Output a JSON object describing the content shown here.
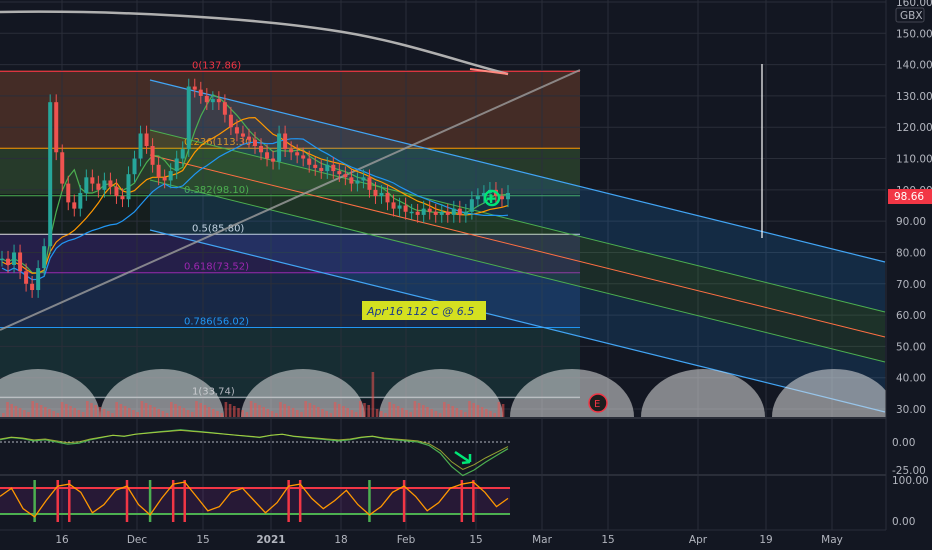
{
  "currency": "GBX",
  "last_price": "98.66",
  "earnings_marker": "E",
  "annotation": "Apr'16 112 C @ 6.5",
  "colors": {
    "background": "#131722",
    "price_badge": "#f23645",
    "channel_blue": "#2962ff",
    "channel_green": "#4caf50",
    "channel_red": "#ff6d00",
    "annotation_bg": "#d4e020"
  },
  "chart_data": [
    {
      "type": "line",
      "id": "price",
      "ylim": [
        30,
        160
      ],
      "y_ticks": [
        "160.00",
        "150.00",
        "140.00",
        "130.00",
        "120.00",
        "110.00",
        "100.00",
        "90.00",
        "80.00",
        "70.00",
        "60.00",
        "50.00",
        "40.00",
        "30.00"
      ],
      "x_ticks": [
        "16",
        "Dec",
        "15",
        "2021",
        "18",
        "Feb",
        "15",
        "Mar",
        "15",
        "Apr",
        "19",
        "May"
      ],
      "fib_levels": [
        {
          "label": "0(137.86)",
          "value": 137.86,
          "color": "#f23645"
        },
        {
          "label": "0.236(113.30)",
          "value": 113.3,
          "color": "#ff9800"
        },
        {
          "label": "0.382(98.10)",
          "value": 98.1,
          "color": "#4caf50"
        },
        {
          "label": "0.5(85.80)",
          "value": 85.8,
          "color": "#e0e0e0"
        },
        {
          "label": "0.618(73.52)",
          "value": 73.52,
          "color": "#9c27b0"
        },
        {
          "label": "0.786(56.02)",
          "value": 56.02,
          "color": "#2196f3"
        },
        {
          "label": "1(33.74)",
          "value": 33.74,
          "color": "#b2b5be"
        }
      ],
      "series": [
        {
          "values": [
            78,
            76,
            80,
            74,
            70,
            68,
            75,
            82,
            128,
            112,
            102,
            96,
            94,
            99,
            104,
            102,
            100,
            103,
            101,
            98,
            97,
            105,
            110,
            118,
            114,
            108,
            104,
            103,
            106,
            110,
            113,
            133,
            132,
            130,
            128,
            129,
            128,
            124,
            120,
            118,
            117,
            116,
            114,
            112,
            110,
            109,
            118,
            113,
            112,
            111,
            110,
            108,
            107,
            106,
            108,
            106,
            105,
            104,
            102,
            103,
            104,
            100,
            98,
            99,
            96,
            94,
            95,
            93,
            93,
            92,
            94,
            93,
            92,
            93,
            92,
            94,
            92,
            93,
            97,
            98,
            99,
            100,
            98,
            97,
            99
          ]
        }
      ]
    },
    {
      "type": "line",
      "id": "oscillator",
      "y_ticks": [
        "0.00",
        "-25.00"
      ],
      "series": [
        {
          "values": [
            2,
            4,
            3,
            1,
            2,
            0,
            -2,
            -1,
            2,
            4,
            6,
            5,
            7,
            8,
            9,
            10,
            11,
            10,
            9,
            8,
            7,
            6,
            5,
            4,
            6,
            7,
            5,
            4,
            3,
            2,
            1,
            2,
            4,
            5,
            3,
            2,
            1,
            0,
            -3,
            -10,
            -22,
            -30,
            -25,
            -18,
            -12,
            -6
          ]
        }
      ]
    },
    {
      "type": "line",
      "id": "stochastic",
      "y_ticks": [
        "100.00",
        "0.00"
      ],
      "series": [
        {
          "values": [
            60,
            80,
            30,
            10,
            50,
            85,
            90,
            70,
            20,
            40,
            75,
            85,
            40,
            15,
            55,
            90,
            95,
            60,
            25,
            35,
            70,
            80,
            50,
            20,
            45,
            85,
            90,
            55,
            30,
            50,
            75,
            40,
            15,
            35,
            70,
            85,
            60,
            25,
            45,
            80,
            90,
            95,
            70,
            35,
            55
          ]
        }
      ]
    }
  ]
}
